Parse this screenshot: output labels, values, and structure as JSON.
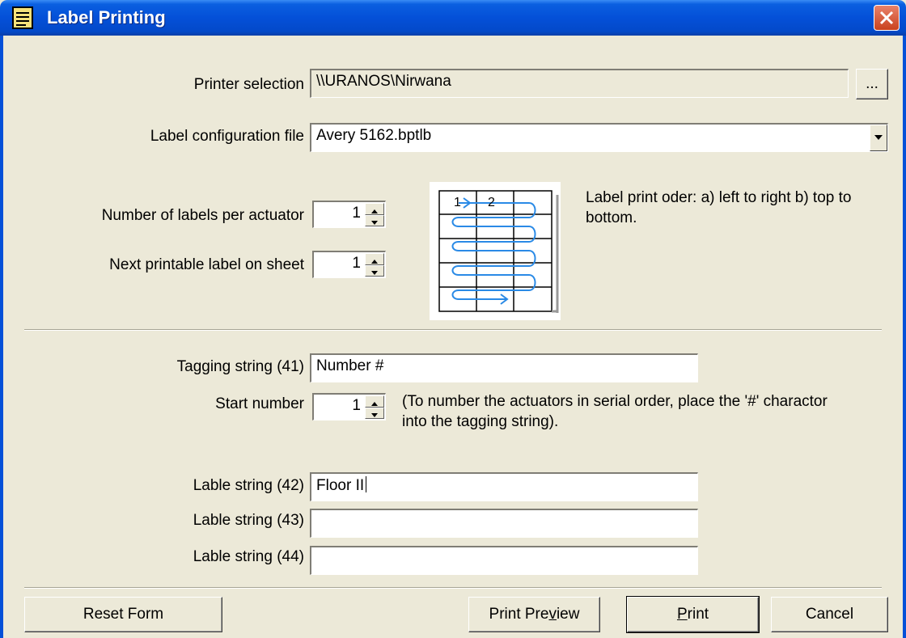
{
  "window": {
    "title": "Label Printing"
  },
  "printer": {
    "label": "Printer selection",
    "value": "\\\\URANOS\\Nirwana",
    "browse_label": "..."
  },
  "config": {
    "label": "Label configuration file",
    "value": "Avery 5162.bptlb"
  },
  "labels_per_actuator": {
    "label": "Number of labels per actuator",
    "value": "1"
  },
  "next_label": {
    "label": "Next printable label on sheet",
    "value": "1"
  },
  "diagram": {
    "cell1": "1",
    "cell2": "2"
  },
  "print_order_text": "Label print oder: a) left to right  b) top to bottom.",
  "tagging": {
    "label": "Tagging string (41)",
    "value": "Number #"
  },
  "start_number": {
    "label": "Start number",
    "value": "1"
  },
  "serial_hint": "(To number the actuators in serial order, place the '#' charactor into the tagging string).",
  "lable_strings": [
    {
      "label": "Lable string (42)",
      "value": "Floor II"
    },
    {
      "label": "Lable string (43)",
      "value": ""
    },
    {
      "label": "Lable string (44)",
      "value": ""
    }
  ],
  "buttons": {
    "reset": "Reset Form",
    "preview_pre": "Print Pre",
    "preview_acc": "v",
    "preview_post": "iew",
    "print_acc": "P",
    "print_post": "rint",
    "cancel": "Cancel"
  }
}
